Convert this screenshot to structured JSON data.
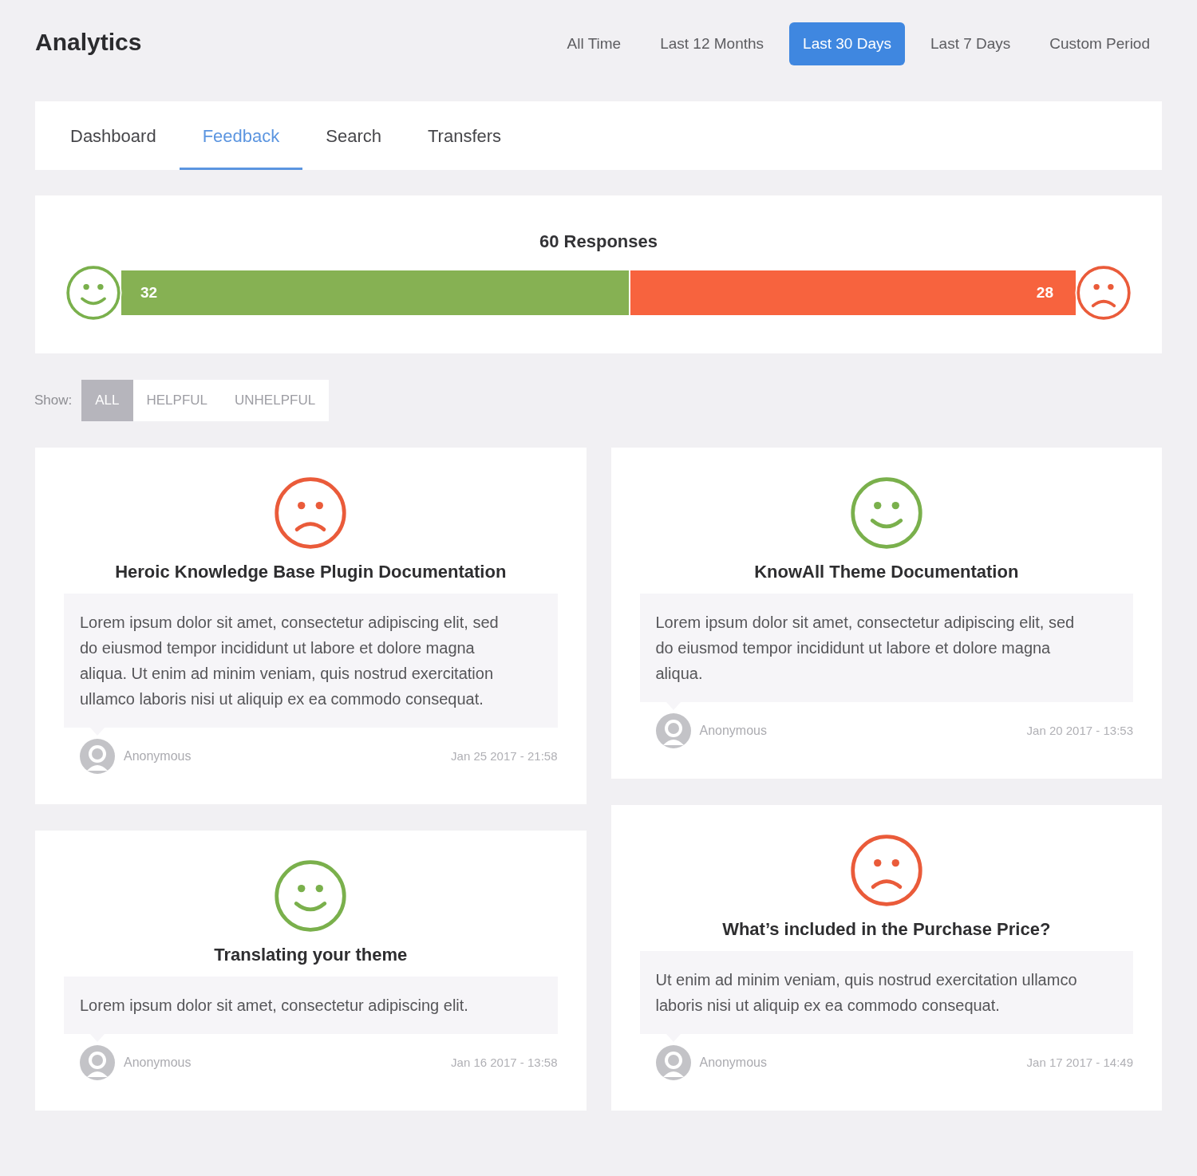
{
  "header": {
    "title": "Analytics",
    "periods": [
      {
        "label": "All Time",
        "selected": false
      },
      {
        "label": "Last 12 Months",
        "selected": false
      },
      {
        "label": "Last 30 Days",
        "selected": true
      },
      {
        "label": "Last 7 Days",
        "selected": false
      },
      {
        "label": "Custom Period",
        "selected": false
      }
    ]
  },
  "tabs": [
    {
      "label": "Dashboard",
      "selected": false
    },
    {
      "label": "Feedback",
      "selected": true
    },
    {
      "label": "Search",
      "selected": false
    },
    {
      "label": "Transfers",
      "selected": false
    }
  ],
  "summary": {
    "title": "60 Responses",
    "segments": [
      {
        "kind": "helpful",
        "count": "32",
        "level": 0.533
      },
      {
        "kind": "unhelpful",
        "count": "28",
        "level": 0.467
      }
    ]
  },
  "filter": {
    "label": "Show:",
    "options": [
      {
        "label": "ALL",
        "selected": true
      },
      {
        "label": "HELPFUL",
        "selected": false
      },
      {
        "label": "UNHELPFUL",
        "selected": false
      }
    ]
  },
  "columns": [
    {
      "cards": [
        {
          "kind": "unhelpful",
          "title": "Heroic Knowledge Base Plugin Documentation",
          "comment": "Lorem ipsum dolor sit amet, consectetur adipiscing elit, sed do eiusmod tempor incididunt ut labore et dolore magna aliqua. Ut enim ad minim veniam, quis nostrud exercitation ullamco laboris nisi ut aliquip ex ea commodo consequat.",
          "author": "Anonymous",
          "date": "Jan 25 2017 - 21:58"
        },
        {
          "kind": "helpful",
          "title": "Translating your theme",
          "comment": "Lorem ipsum dolor sit amet, consectetur adipiscing elit.",
          "author": "Anonymous",
          "date": "Jan 16 2017 - 13:58"
        }
      ]
    },
    {
      "cards": [
        {
          "kind": "helpful",
          "title": "KnowAll Theme Documentation",
          "comment": "Lorem ipsum dolor sit amet, consectetur adipiscing elit, sed do eiusmod tempor incididunt ut labore et dolore magna aliqua.",
          "author": "Anonymous",
          "date": "Jan 20 2017 - 13:53"
        },
        {
          "kind": "unhelpful",
          "title": "What’s included in the Purchase Price?",
          "comment": "Ut enim ad minim veniam, quis nostrud exercitation ullamco laboris nisi ut aliquip ex ea commodo consequat.",
          "author": "Anonymous",
          "date": "Jan 17 2017 - 14:49"
        }
      ]
    }
  ]
}
